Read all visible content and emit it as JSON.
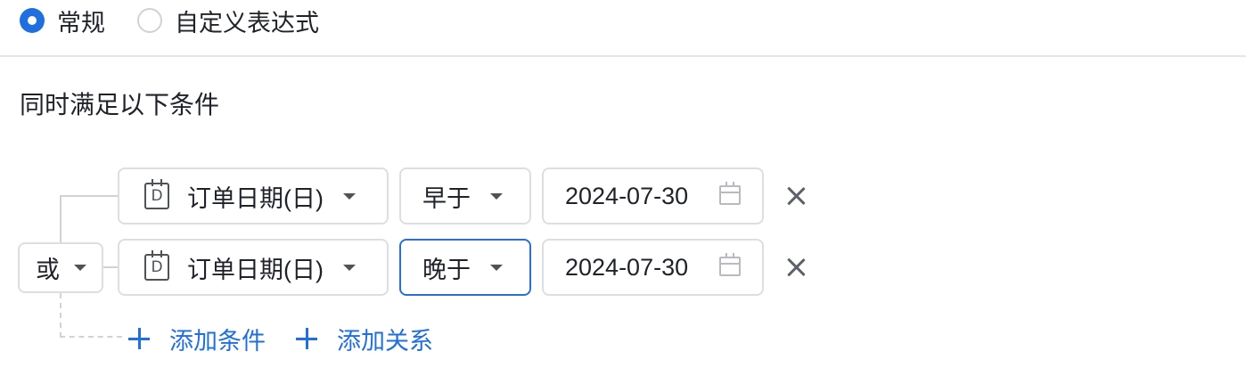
{
  "mode_options": [
    {
      "label": "常规",
      "checked": true
    },
    {
      "label": "自定义表达式",
      "checked": false
    }
  ],
  "section_title": "同时满足以下条件",
  "relation": {
    "label": "或"
  },
  "conditions": [
    {
      "field": "订单日期(日)",
      "field_icon": "D",
      "operator": "早于",
      "value": "2024-07-30"
    },
    {
      "field": "订单日期(日)",
      "field_icon": "D",
      "operator": "晚于",
      "value": "2024-07-30"
    }
  ],
  "actions": {
    "add_condition": "添加条件",
    "add_relation": "添加关系"
  },
  "icons": {
    "field_type": "date-field-icon",
    "value": "calendar-icon",
    "remove": "close-icon",
    "add": "plus-icon"
  },
  "colors": {
    "accent": "#1f6fde",
    "border": "#dcdee1",
    "active_border": "#2a6fd6",
    "text": "#1f2329"
  }
}
